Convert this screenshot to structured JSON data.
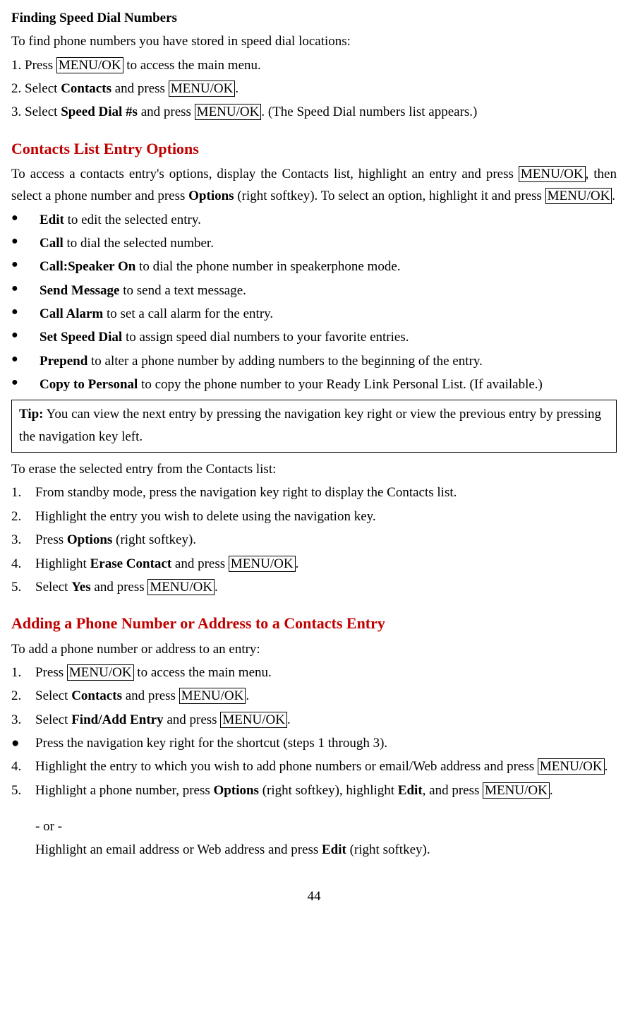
{
  "s1": {
    "title": "Finding Speed Dial Numbers",
    "intro": "To find phone numbers you have stored in speed dial locations:",
    "step1_a": "1. Press ",
    "step1_key": "MENU/OK",
    "step1_b": " to access the main menu.",
    "step2_a": "2. Select ",
    "step2_bold": "Contacts",
    "step2_b": " and press ",
    "step2_key": "MENU/OK",
    "step2_c": ".",
    "step3_a": "3. Select ",
    "step3_bold": "Speed Dial #s",
    "step3_b": " and press ",
    "step3_key": "MENU/OK",
    "step3_c": ". (The Speed Dial numbers list appears.)"
  },
  "s2": {
    "heading": "Contacts List Entry Options",
    "para_a": "To access a contacts entry's options, display the Contacts list, highlight an entry and press ",
    "para_key1": "MENU/OK",
    "para_b": ", then select a phone number and press ",
    "para_bold1": "Options",
    "para_c": " (right softkey). To select an option, highlight it and press ",
    "para_key2": "MENU/OK",
    "para_d": ".",
    "bullets": {
      "b1a": "Edit",
      "b1b": " to edit the selected entry.",
      "b2a": "Call",
      "b2b": " to dial the selected number.",
      "b3a": "Call:Speaker On",
      "b3b": " to dial the phone number in speakerphone mode.",
      "b4a": "Send Message",
      "b4b": " to send a text message.",
      "b5a": "Call Alarm",
      "b5b": " to set a call alarm for the entry.",
      "b6a": "Set Speed Dial",
      "b6b": " to assign speed dial numbers to your favorite entries.",
      "b7a": "Prepend",
      "b7b": " to alter a phone number by adding numbers to the beginning of the entry.",
      "b8a": "Copy to Personal",
      "b8b": " to copy the phone number to your Ready Link Personal List. (If available.)"
    },
    "tip_label": "Tip:",
    "tip_text": " You can view the next entry by pressing the navigation key right or view the previous entry by pressing the navigation key left.",
    "erase_intro": "To erase the selected entry from the Contacts list:",
    "e1": "From standby mode, press the navigation key right to display the Contacts list.",
    "e2": "Highlight the entry you wish to delete using the navigation key.",
    "e3a": "Press ",
    "e3bold": "Options",
    "e3b": " (right softkey).",
    "e4a": "Highlight ",
    "e4bold": "Erase Contact",
    "e4b": " and press ",
    "e4key": "MENU/OK",
    "e4c": ".",
    "e5a": "Select ",
    "e5bold": "Yes",
    "e5b": " and press ",
    "e5key": "MENU/OK",
    "e5c": "."
  },
  "s3": {
    "heading": "Adding a Phone Number or Address to a Contacts Entry",
    "intro": "To add a phone number or address to an entry:",
    "n1a": "Press ",
    "n1key": "MENU/OK",
    "n1b": " to access the main menu.",
    "n2a": "Select ",
    "n2bold": "Contacts",
    "n2b": " and press ",
    "n2key": "MENU/OK",
    "n2c": ".",
    "n3a": "Select ",
    "n3bold": "Find/Add Entry",
    "n3b": " and press ",
    "n3key": "MENU/OK",
    "n3c": ".",
    "nbullet": "Press the navigation key right for the shortcut (steps 1 through 3).",
    "n4a": "Highlight the entry to which you wish to add phone numbers or email/Web address and press ",
    "n4key": "MENU/OK",
    "n4b": ".",
    "n5a": "Highlight a phone number, press ",
    "n5bold1": "Options",
    "n5b": " (right softkey), highlight ",
    "n5bold2": "Edit",
    "n5c": ", and press ",
    "n5key": "MENU/OK",
    "n5d": ".",
    "or": "- or -",
    "alt_a": "Highlight an email address or Web address and press ",
    "alt_bold": "Edit",
    "alt_b": " (right softkey)."
  },
  "page_number": "44",
  "nums": {
    "n1": "1.",
    "n2": "2.",
    "n3": "3.",
    "n4": "4.",
    "n5": "5."
  },
  "marks": {
    "dot": "●"
  }
}
